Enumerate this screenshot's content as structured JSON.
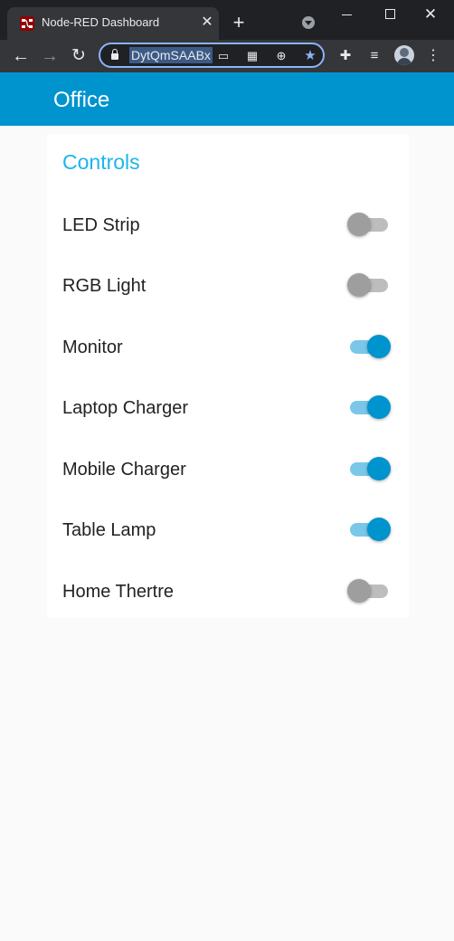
{
  "browser": {
    "tab_title": "Node-RED Dashboard",
    "tab_close": "✕",
    "new_tab": "+",
    "url_text": "DytQmSAABx",
    "menu_glyph": "⋮"
  },
  "header": {
    "title": "Office",
    "color": "#0094ce"
  },
  "group": {
    "title": "Controls",
    "title_color": "#1bb5ea",
    "switches": [
      {
        "label": "LED Strip",
        "on": false
      },
      {
        "label": "RGB Light",
        "on": false
      },
      {
        "label": "Monitor",
        "on": true
      },
      {
        "label": "Laptop Charger",
        "on": true
      },
      {
        "label": "Mobile Charger",
        "on": true
      },
      {
        "label": "Table Lamp",
        "on": true
      },
      {
        "label": "Home Thertre",
        "on": false
      }
    ]
  },
  "colors": {
    "switch_on_knob": "#0094ce",
    "switch_on_track": "#7ac7ea",
    "switch_off_knob": "#9e9e9e",
    "switch_off_track": "#bdbdbd"
  },
  "icons": {
    "back": "back-arrow-icon",
    "forward": "forward-arrow-icon",
    "reload": "reload-icon",
    "lock": "lock-icon",
    "cast": "cast-icon",
    "qr": "qr-code-icon",
    "zoom": "zoom-icon",
    "star": "bookmark-star-icon",
    "extensions": "puzzle-icon",
    "media": "media-control-icon"
  }
}
